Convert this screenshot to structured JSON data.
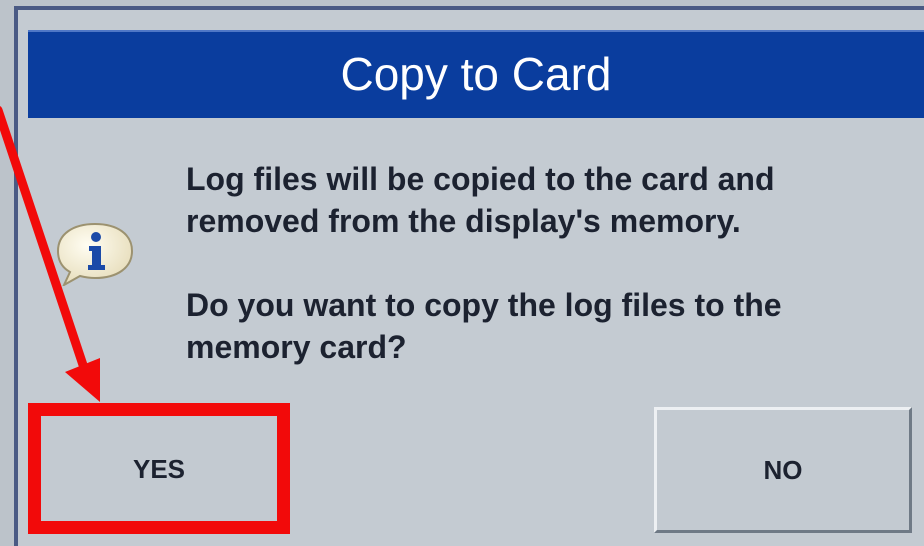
{
  "dialog": {
    "title": "Copy to Card",
    "icon": "info-icon",
    "message_line1": "Log files will be copied to the card and",
    "message_line2": "removed from the display's memory.",
    "question_line1": "Do you want to copy the log files to the",
    "question_line2": "memory card?"
  },
  "buttons": {
    "yes_label": "YES",
    "no_label": "NO"
  },
  "annotation": {
    "color": "#f20a0a",
    "target": "yes-button"
  },
  "colors": {
    "title_bar": "#0a3d9e",
    "dialog_bg": "#c4cbd2"
  }
}
